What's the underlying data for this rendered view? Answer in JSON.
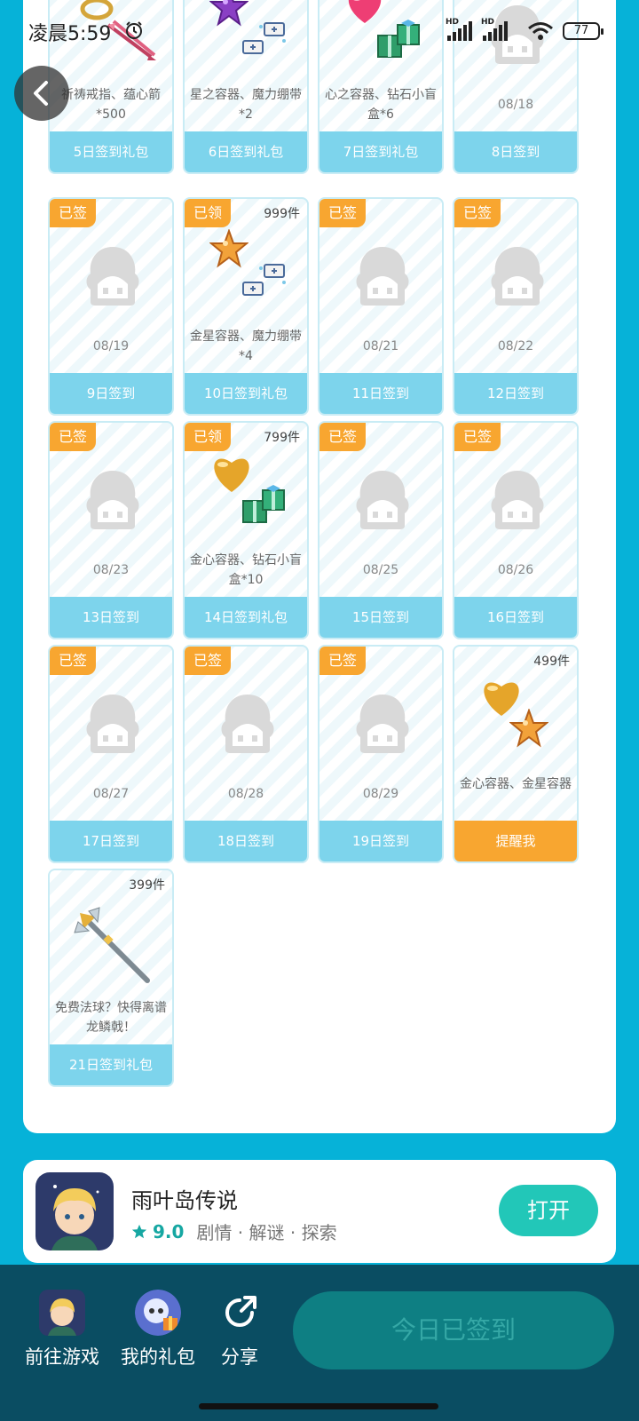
{
  "status": {
    "time": "凌晨5:59",
    "battery": "77",
    "hd_label": "HD"
  },
  "colors": {
    "background": "#06b2d8",
    "badge": "#f8a630",
    "card_button": "#7dd4ec",
    "open_button": "#22c7b8",
    "bottom_bar": "#0a4d62"
  },
  "cards": [
    {
      "id": "d5",
      "button": "5日签到礼包",
      "desc": "祈祷戒指、蕴心箭*500",
      "items": [
        "ring-icon",
        "arrow-icon"
      ]
    },
    {
      "id": "d6",
      "button": "6日签到礼包",
      "desc": "星之容器、魔力绷带*2",
      "items": [
        "purple-star-icon",
        "bandage-icon"
      ]
    },
    {
      "id": "d7",
      "button": "7日签到礼包",
      "desc": "心之容器、钻石小盲盒*6",
      "items": [
        "pink-heart-icon",
        "gift-box-icon"
      ]
    },
    {
      "id": "d8",
      "button": "8日签到",
      "date": "08/18",
      "items": [
        "placeholder-icon"
      ]
    },
    {
      "id": "d9",
      "badge": "已签",
      "button": "9日签到",
      "date": "08/19"
    },
    {
      "id": "d10",
      "badge": "已领",
      "stock": "999件",
      "button": "10日签到礼包",
      "desc": "金星容器、魔力绷带*4",
      "items": [
        "gold-star-icon",
        "bandage-icon"
      ]
    },
    {
      "id": "d11",
      "badge": "已签",
      "button": "11日签到",
      "date": "08/21"
    },
    {
      "id": "d12",
      "badge": "已签",
      "button": "12日签到",
      "date": "08/22"
    },
    {
      "id": "d13",
      "badge": "已签",
      "button": "13日签到",
      "date": "08/23"
    },
    {
      "id": "d14",
      "badge": "已领",
      "stock": "799件",
      "button": "14日签到礼包",
      "desc": "金心容器、钻石小盲盒*10",
      "items": [
        "gold-heart-icon",
        "gift-box-icon"
      ]
    },
    {
      "id": "d15",
      "badge": "已签",
      "button": "15日签到",
      "date": "08/25"
    },
    {
      "id": "d16",
      "badge": "已签",
      "button": "16日签到",
      "date": "08/26"
    },
    {
      "id": "d17",
      "badge": "已签",
      "button": "17日签到",
      "date": "08/27"
    },
    {
      "id": "d18",
      "badge": "已签",
      "button": "18日签到",
      "date": "08/28"
    },
    {
      "id": "d19",
      "badge": "已签",
      "button": "19日签到",
      "date": "08/29"
    },
    {
      "id": "d20",
      "stock": "499件",
      "button": "提醒我",
      "desc": "金心容器、金星容器",
      "items": [
        "gold-heart-icon",
        "gold-star-icon"
      ]
    },
    {
      "id": "d21",
      "stock": "399件",
      "button": "21日签到礼包",
      "desc": "免费法球？快得离谱 龙鳞戟！",
      "items": [
        "halberd-icon"
      ]
    }
  ],
  "app": {
    "name": "雨叶岛传说",
    "rating": "9.0",
    "tags": "剧情 · 解谜 · 探索",
    "open_label": "打开"
  },
  "bottom_nav": [
    {
      "label": "前往游戏",
      "icon": "game-avatar-icon"
    },
    {
      "label": "我的礼包",
      "icon": "gift-bag-icon"
    },
    {
      "label": "分享",
      "icon": "share-icon"
    }
  ],
  "signed_label": "今日已签到"
}
